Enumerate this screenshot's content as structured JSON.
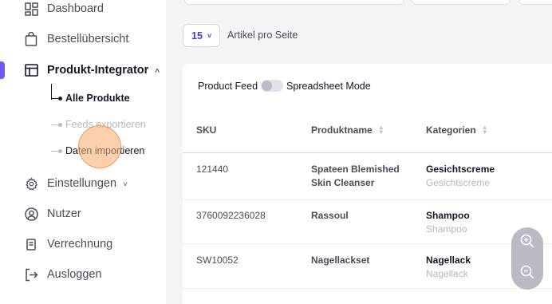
{
  "sidebar": {
    "items": [
      {
        "label": "Dashboard",
        "icon": "dashboard-icon"
      },
      {
        "label": "Bestellübersicht",
        "icon": "shopping-bag-icon"
      },
      {
        "label": "Produkt-Integrator",
        "icon": "table-icon",
        "active": true
      },
      {
        "label": "Einstellungen",
        "icon": "gear-icon"
      },
      {
        "label": "Nutzer",
        "icon": "user-icon"
      },
      {
        "label": "Verrechnung",
        "icon": "receipt-icon"
      },
      {
        "label": "Ausloggen",
        "icon": "logout-icon"
      }
    ],
    "subitems": [
      {
        "label": "Alle Produkte"
      },
      {
        "label": "Feeds exportieren"
      },
      {
        "label": "Daten importieren"
      }
    ]
  },
  "pagination": {
    "per_page_value": "15",
    "per_page_label": "Artikel pro Seite"
  },
  "feed_toggle": {
    "left_label": "Product Feed",
    "right_label": "Spreadsheet Mode"
  },
  "table": {
    "headers": [
      "SKU",
      "Produktname",
      "Kategorien"
    ],
    "rows": [
      {
        "sku": "121440",
        "name_line1": "Spateen Blemished",
        "name_line2": "Skin Cleanser",
        "category": "Gesichtscreme",
        "category_sub": "Gesichtscreme"
      },
      {
        "sku": "3760092236028",
        "name_line1": "Rassoul",
        "name_line2": "",
        "category": "Shampoo",
        "category_sub": "Shampoo"
      },
      {
        "sku": "SW10052",
        "name_line1": "Nagellackset",
        "name_line2": "",
        "category": "Nagellack",
        "category_sub": "Nagellack"
      }
    ]
  },
  "colors": {
    "accent": "#6c5cf0",
    "select_text": "#4a3cd8",
    "click_indicator": "#f9aa6e"
  }
}
